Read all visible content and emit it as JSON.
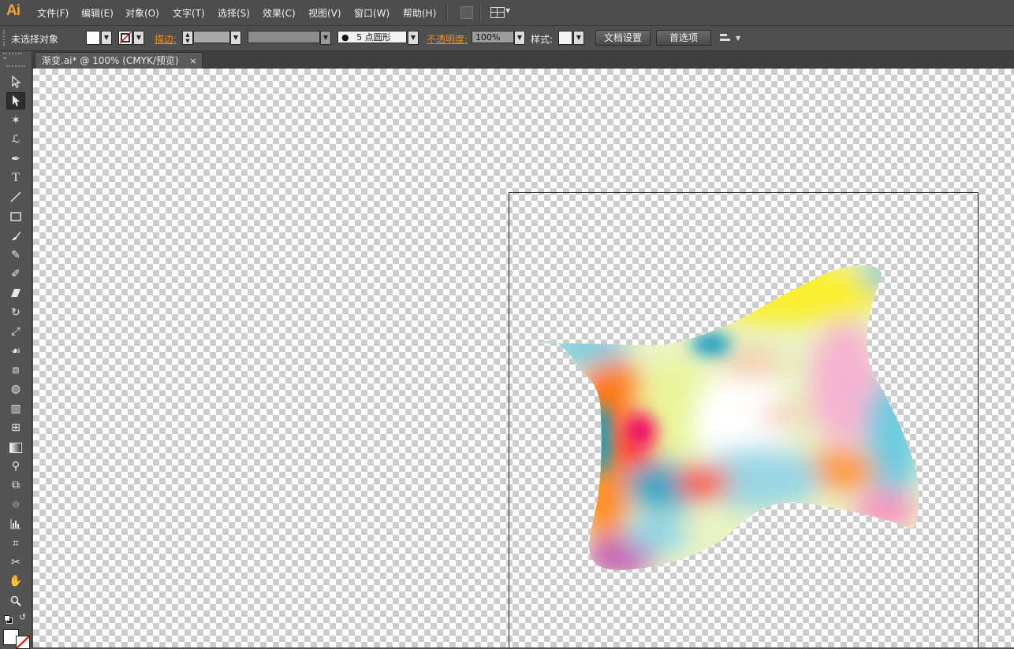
{
  "app": {
    "logo": "Ai"
  },
  "menu": [
    "文件(F)",
    "编辑(E)",
    "对象(O)",
    "文字(T)",
    "选择(S)",
    "效果(C)",
    "视图(V)",
    "窗口(W)",
    "帮助(H)"
  ],
  "control": {
    "selection": "未选择对象",
    "stroke_label": "描边:",
    "brush": "5 点圆形",
    "opacity_label": "不透明度:",
    "opacity_value": "100%",
    "style_label": "样式:",
    "doc_setup": "文档设置",
    "preferences": "首选项"
  },
  "document": {
    "tab": "渐变.ai* @ 100% (CMYK/预览)",
    "close": "×"
  },
  "colors": {
    "accent": "#f08b1e",
    "panel": "#535353"
  },
  "tools": [
    "selection-tool",
    "direct-selection-tool",
    "magic-wand-tool",
    "lasso-tool",
    "pen-tool",
    "type-tool",
    "line-tool",
    "rectangle-tool",
    "paintbrush-tool",
    "pencil-tool",
    "blob-brush-tool",
    "eraser-tool",
    "rotate-tool",
    "scale-tool",
    "warp-tool",
    "free-transform-tool",
    "shape-builder-tool",
    "perspective-grid-tool",
    "mesh-tool",
    "gradient-tool",
    "eyedropper-tool",
    "blend-tool",
    "symbol-sprayer-tool",
    "column-graph-tool",
    "artboard-tool",
    "slice-tool",
    "hand-tool",
    "zoom-tool"
  ]
}
